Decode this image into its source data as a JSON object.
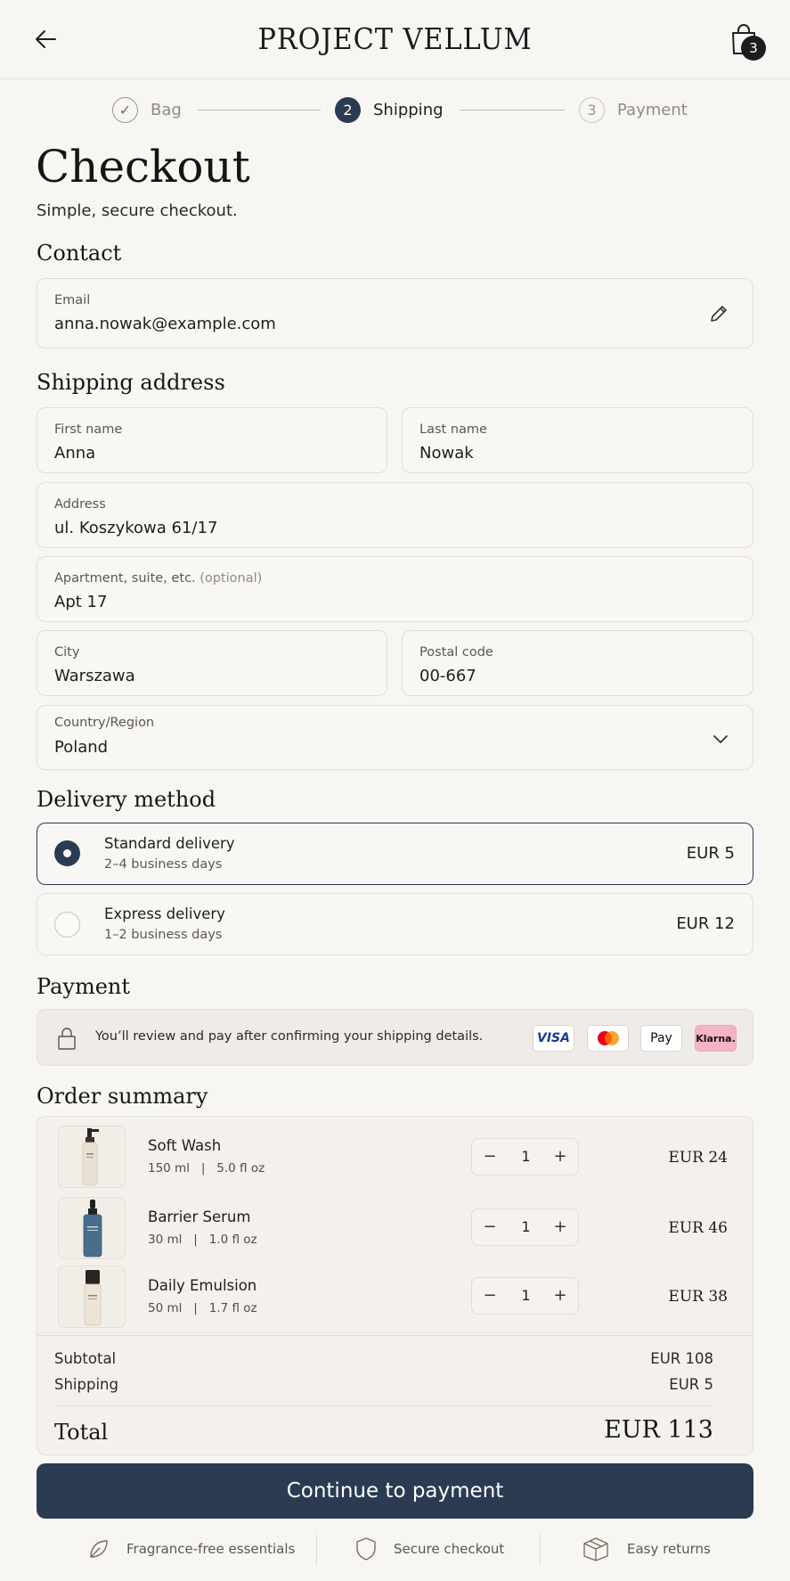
{
  "header": {
    "brand": "PROJECT VELLUM",
    "back_icon": "arrow-left-icon",
    "bag_icon": "shopping-bag-icon",
    "bag_count": "3"
  },
  "stepper": {
    "steps": [
      {
        "label": "Bag",
        "marker": "✓",
        "state": "done"
      },
      {
        "label": "Shipping",
        "marker": "2",
        "state": "active"
      },
      {
        "label": "Payment",
        "marker": "3",
        "state": "todo"
      }
    ]
  },
  "page": {
    "title": "Checkout",
    "subtitle": "Simple, secure checkout."
  },
  "contact": {
    "title": "Contact",
    "email_label": "Email",
    "email_value": "anna.nowak@example.com",
    "edit_icon": "pencil-icon"
  },
  "shipping": {
    "title": "Shipping address",
    "first_name_label": "First name",
    "first_name": "Anna",
    "last_name_label": "Last name",
    "last_name": "Nowak",
    "address_label": "Address",
    "address": "ul. Koszykowa 61/17",
    "apartment_label": "Apartment, suite, etc.",
    "apartment_optional": "(optional)",
    "apartment": "Apt 17",
    "city_label": "City",
    "city": "Warszawa",
    "postal_label": "Postal code",
    "postal": "00-667",
    "country_label": "Country/Region",
    "country": "Poland"
  },
  "delivery": {
    "title": "Delivery method",
    "options": [
      {
        "name": "Standard delivery",
        "time": "2–4 business days",
        "price": "EUR 5",
        "selected": true
      },
      {
        "name": "Express delivery",
        "time": "1–2 business days",
        "price": "EUR 12",
        "selected": false
      }
    ]
  },
  "payment": {
    "title": "Payment",
    "note": "You’ll review and pay after confirming your shipping details.",
    "lock_icon": "lock-icon",
    "methods": [
      "VISA",
      "Mastercard",
      "Pay",
      "Klarna."
    ]
  },
  "summary": {
    "title": "Order summary",
    "items": [
      {
        "name": "Soft Wash",
        "size_ml": "150 ml",
        "size_oz": "5.0 fl oz",
        "qty": "1",
        "price": "EUR 24"
      },
      {
        "name": "Barrier Serum",
        "size_ml": "30 ml",
        "size_oz": "1.0 fl oz",
        "qty": "1",
        "price": "EUR 46"
      },
      {
        "name": "Daily Emulsion",
        "size_ml": "50 ml",
        "size_oz": "1.7 fl oz",
        "qty": "1",
        "price": "EUR 38"
      }
    ],
    "subtotal_label": "Subtotal",
    "subtotal": "EUR 108",
    "shipping_label": "Shipping",
    "shipping": "EUR 5",
    "total_label": "Total",
    "total": "EUR 113",
    "separator": "|",
    "minus": "−",
    "plus": "+"
  },
  "cta": {
    "label": "Continue to payment"
  },
  "footer": {
    "badges": [
      {
        "icon": "leaf-icon",
        "label": "Fragrance-free essentials"
      },
      {
        "icon": "shield-icon",
        "label": "Secure checkout"
      },
      {
        "icon": "box-icon",
        "label": "Easy returns"
      }
    ]
  },
  "colors": {
    "primary": "#2a3b52",
    "background": "#f8f6f3"
  }
}
